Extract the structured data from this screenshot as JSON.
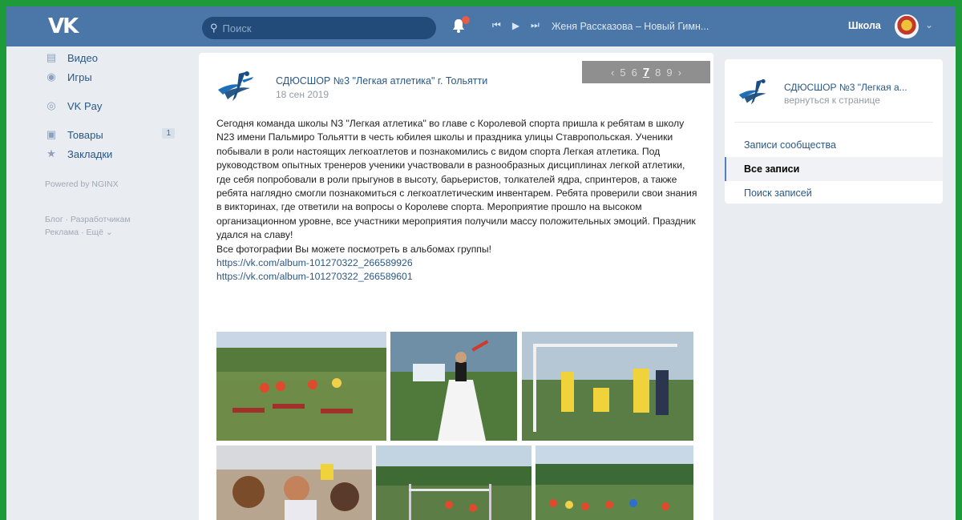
{
  "topbar": {
    "logo": "VK",
    "search_placeholder": "Поиск",
    "search_icon": "search-icon",
    "notifications_icon": "bell-icon",
    "player": {
      "prev": "⏮",
      "play": "▶",
      "next": "⏭",
      "track": "Женя Рассказова – Новый Гимн..."
    },
    "profile_name": "Школа",
    "caret": "⌄"
  },
  "leftmenu": {
    "items": [
      {
        "label": "Видео",
        "icon": "video-icon"
      },
      {
        "label": "Игры",
        "icon": "games-icon"
      },
      {
        "label": "VK Pay",
        "icon": "vkpay-icon"
      },
      {
        "label": "Товары",
        "icon": "goods-icon",
        "badge": "1"
      },
      {
        "label": "Закладки",
        "icon": "bookmarks-icon"
      }
    ],
    "powered": "Powered by NGINX",
    "footer_line1": "Блог · Разработчикам",
    "footer_line2": "Реклама · Ещё ⌄"
  },
  "post": {
    "author": "СДЮСШОР №3 \"Легкая атлетика\" г. Тольятти",
    "date": "18 сен 2019",
    "pager": [
      "‹",
      "5",
      "6",
      "7",
      "8",
      "9",
      "›"
    ],
    "pager_active": "7",
    "text": "Сегодня команда школы N3 \"Легкая атлетика\" во главе с Королевой спорта пришла к ребятам в школу N23 имени Пальмиро Тольятти в честь юбилея школы и праздника улицы Ставропольская. Ученики побывали в роли настоящих легкоатлетов и познакомились с видом спорта Легкая атлетика. Под руководством опытных тренеров ученики участвовали в разнообразных дисциплинах легкой атлетики, где себя попробовали в роли прыгунов в высоту, барьеристов, толкателей ядра, спринтеров, а также ребята наглядно смогли познакомиться с легкоатлетическим инвентарем. Ребята проверили свои знания в викторинах, где ответили на вопросы о Королеве спорта. Мероприятие прошло на высоком организационном уровне, все участники мероприятия получили массу положительных эмоций. Праздник удался на славу!",
    "text2": "Все фотографии Вы можете посмотреть в альбомах группы!",
    "link1": "https://vk.com/album-101270322_266589926",
    "link2": "https://vk.com/album-101270322_266589601"
  },
  "rightcol": {
    "title": "СДЮСШОР №3 \"Легкая а...",
    "subtitle": "вернуться к странице",
    "items": [
      {
        "label": "Записи сообщества",
        "active": false
      },
      {
        "label": "Все записи",
        "active": true
      },
      {
        "label": "Поиск записей",
        "active": false
      }
    ]
  },
  "colors": {
    "header": "#4a76a8",
    "link": "#2a5885",
    "frame_border": "#1f9a3a",
    "page_bg": "#e9ecf0"
  }
}
